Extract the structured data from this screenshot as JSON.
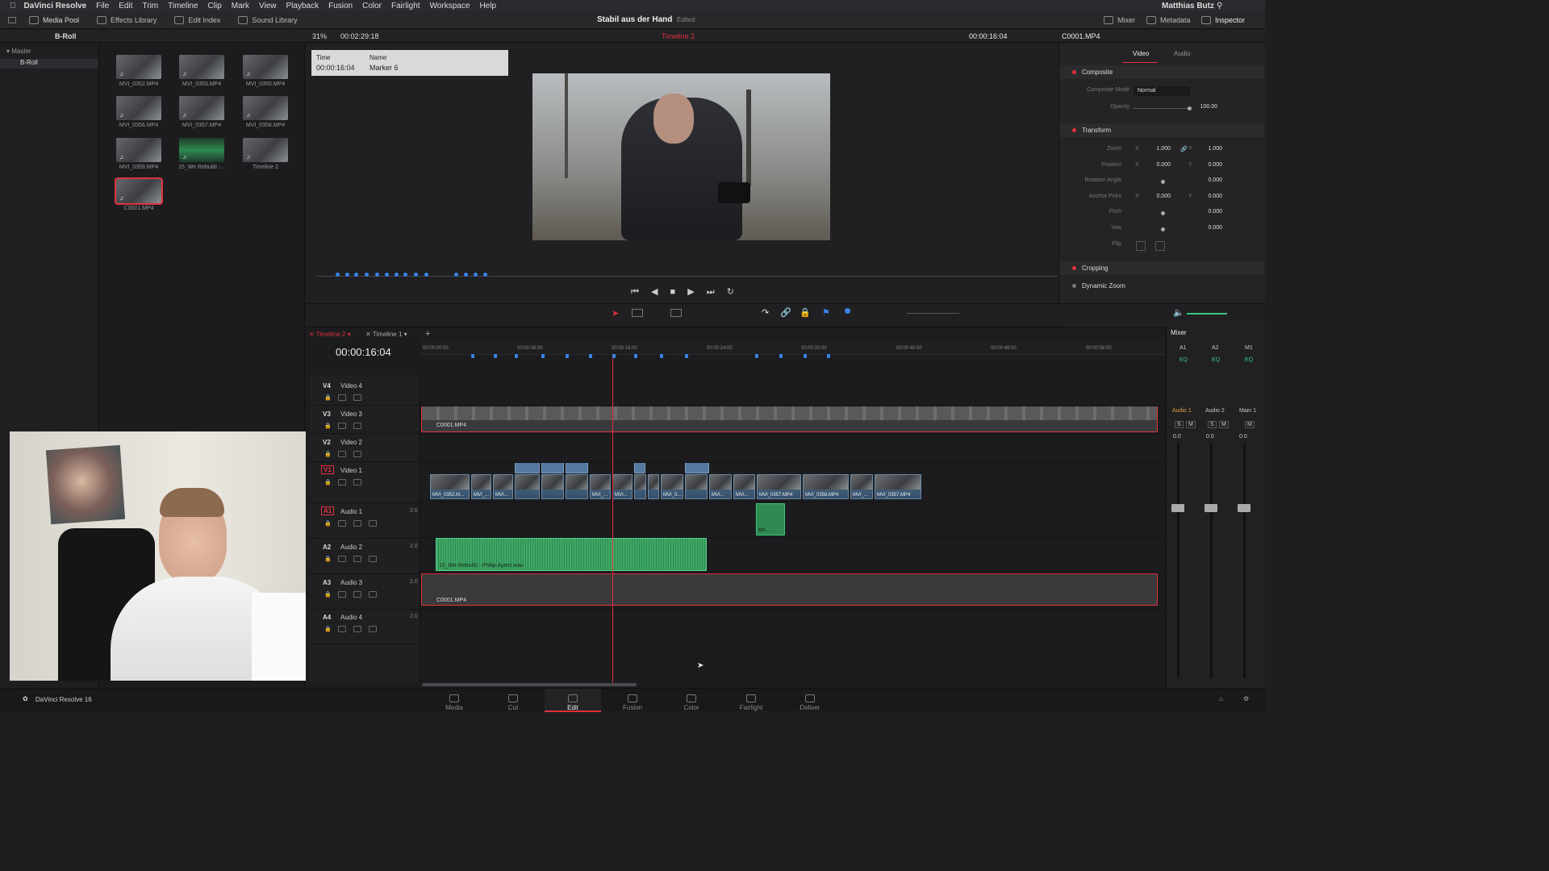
{
  "menubar": {
    "app": "DaVinci Resolve",
    "items": [
      "File",
      "Edit",
      "Trim",
      "Timeline",
      "Clip",
      "Mark",
      "View",
      "Playback",
      "Fusion",
      "Color",
      "Fairlight",
      "Workspace",
      "Help"
    ],
    "user": "Matthias Butz"
  },
  "topbar": {
    "media_pool": "Media Pool",
    "effects": "Effects Library",
    "edit_index": "Edit Index",
    "sound": "Sound Library",
    "project": "Stabil aus der Hand",
    "status": "Edited",
    "mixer": "Mixer",
    "metadata": "Metadata",
    "inspector": "Inspector"
  },
  "subbar": {
    "bin": "B-Roll",
    "zoom": "31%",
    "duration": "00:02:29:18",
    "timeline": "Timeline 2",
    "timecode": "00:00:16:04",
    "clip": "C0001.MP4"
  },
  "bins": {
    "master": "Master",
    "broll": "B-Roll"
  },
  "pool": [
    {
      "name": "MVI_0352.MP4"
    },
    {
      "name": "MVI_0353.MP4"
    },
    {
      "name": "MVI_0355.MP4"
    },
    {
      "name": "MVI_0356.MP4"
    },
    {
      "name": "MVI_0357.MP4"
    },
    {
      "name": "MVI_0358.MP4"
    },
    {
      "name": "MVI_0359.MP4"
    },
    {
      "name": "15_We Rebuild -..."
    },
    {
      "name": "Timeline 2"
    },
    {
      "name": "C0001.MP4"
    }
  ],
  "marker": {
    "time_h": "Time",
    "name_h": "Name",
    "time": "00:00:16:04",
    "name": "Marker 6"
  },
  "inspector": {
    "tab_video": "Video",
    "tab_audio": "Audio",
    "composite": "Composite",
    "composite_mode_label": "Composite Mode",
    "composite_mode": "Normal",
    "opacity_label": "Opacity",
    "opacity": "100.00",
    "transform": "Transform",
    "zoom_label": "Zoom",
    "zoom_x": "1.000",
    "zoom_y": "1.000",
    "position_label": "Position",
    "pos_x": "0.000",
    "pos_y": "0.000",
    "rotation_label": "Rotation Angle",
    "rotation": "0.000",
    "anchor_label": "Anchor Point",
    "anchor_x": "0.000",
    "anchor_y": "0.000",
    "pitch_label": "Pitch",
    "pitch": "0.000",
    "yaw_label": "Yaw",
    "yaw": "0.000",
    "flip_label": "Flip",
    "cropping": "Cropping",
    "dynamic_zoom": "Dynamic Zoom",
    "x": "X",
    "y": "Y"
  },
  "timeline": {
    "tab1": "Timeline 2",
    "tab2": "Timeline 1",
    "timecode": "00:00:16:04",
    "ruler": [
      "00:00:00:00",
      "00:00:08:00",
      "00:00:16:00",
      "00:00:24:00",
      "00:00:32:00",
      "00:00:40:00",
      "00:00:48:00",
      "00:00:56:00"
    ]
  },
  "tracks": [
    {
      "id": "V4",
      "name": "Video 4"
    },
    {
      "id": "V3",
      "name": "Video 3"
    },
    {
      "id": "V2",
      "name": "Video 2"
    },
    {
      "id": "V1",
      "name": "Video 1"
    },
    {
      "id": "A1",
      "name": "Audio 1",
      "ch": "2.0"
    },
    {
      "id": "A2",
      "name": "Audio 2",
      "ch": "2.0"
    },
    {
      "id": "A3",
      "name": "Audio 3",
      "ch": "2.0"
    },
    {
      "id": "A4",
      "name": "Audio 4",
      "ch": "2.0"
    }
  ],
  "clips": {
    "v3": "C0001.MP4",
    "a3": "C0001.MP4",
    "a2": "15_We Rebuild - Philip Ayers.wav",
    "a1": "MV...",
    "v1": [
      "MVI_0352.M...",
      "MVI_...",
      "MVI...",
      "MVI_...",
      "MVI...",
      "MVI_0...",
      "MVI...",
      "MVI...",
      "MVI_0357.MP4",
      "MVI_0358.MP4",
      "MVI_...",
      "MVI_0357.MP4"
    ]
  },
  "mixer": {
    "title": "Mixer",
    "a1": "A1",
    "a2": "A2",
    "m1": "M1",
    "eq": "EQ",
    "audio1": "Audio 1",
    "audio2": "Audio 2",
    "main1": "Main 1",
    "s": "S",
    "m": "M",
    "zero": "0.0"
  },
  "pages": [
    "Media",
    "Cut",
    "Edit",
    "Fusion",
    "Color",
    "Fairlight",
    "Deliver"
  ],
  "footer": {
    "app": "DaVinci Resolve 16"
  }
}
